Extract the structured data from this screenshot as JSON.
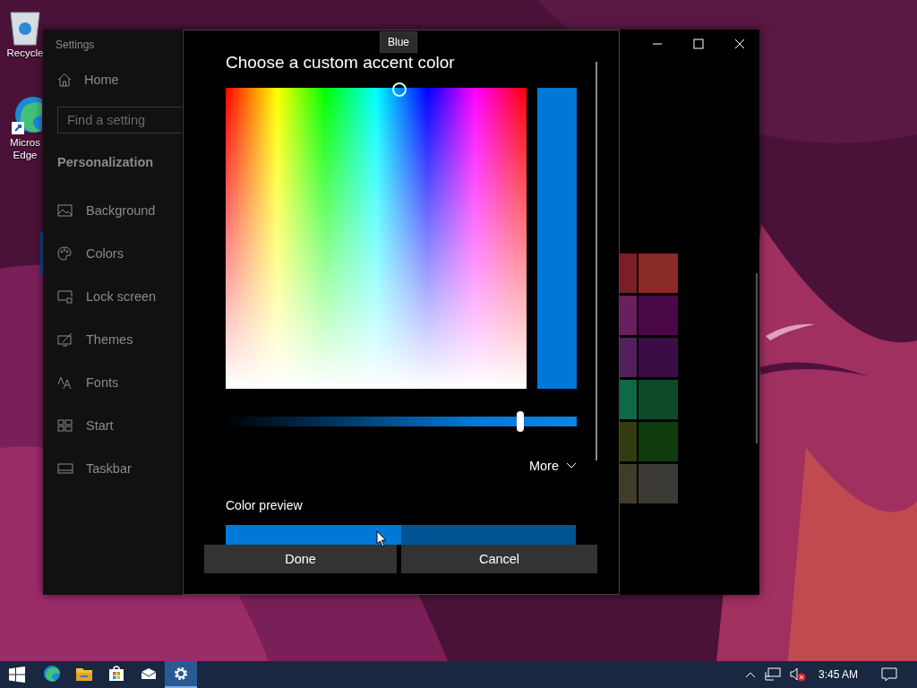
{
  "desktop_icons": [
    {
      "kind": "recycle",
      "label": "Recycle"
    },
    {
      "kind": "edge",
      "label": "Micros Edge"
    }
  ],
  "settings_window": {
    "title": "Settings",
    "home": "Home",
    "search": {
      "placeholder": "Find a setting"
    },
    "section": "Personalization",
    "nav": [
      {
        "kind": "background",
        "label": "Background",
        "selected": false
      },
      {
        "kind": "colors",
        "label": "Colors",
        "selected": true
      },
      {
        "kind": "lock",
        "label": "Lock screen",
        "selected": false
      },
      {
        "kind": "themes",
        "label": "Themes",
        "selected": false
      },
      {
        "kind": "fonts",
        "label": "Fonts",
        "selected": false
      },
      {
        "kind": "start",
        "label": "Start",
        "selected": false
      },
      {
        "kind": "taskbar",
        "label": "Taskbar",
        "selected": false
      }
    ],
    "swatches": [
      {
        "color": "#7a1f26"
      },
      {
        "color": "#8a2a24"
      },
      {
        "color": "#6a1f5e"
      },
      {
        "color": "#4a0848"
      },
      {
        "color": "#52205e"
      },
      {
        "color": "#3c0c46"
      },
      {
        "color": "#0d6a42"
      },
      {
        "color": "#0d4a2a"
      },
      {
        "color": "#333c0e"
      },
      {
        "color": "#0e3c0e"
      },
      {
        "color": "#403c2a"
      },
      {
        "color": "#3b3a34"
      }
    ]
  },
  "dialog": {
    "title": "Choose a custom accent color",
    "tooltip": "Blue",
    "slider": {
      "level": 0.84
    },
    "more": "More",
    "preview_label": "Color preview",
    "buttons": [
      "Done",
      "Cancel"
    ]
  },
  "taskbar": {
    "apps": [
      {
        "kind": "edge",
        "selected": false
      },
      {
        "kind": "explorer",
        "selected": false
      },
      {
        "kind": "store",
        "selected": false
      },
      {
        "kind": "mail",
        "selected": false
      },
      {
        "kind": "settings",
        "selected": true
      }
    ],
    "time": "3:45 AM"
  }
}
